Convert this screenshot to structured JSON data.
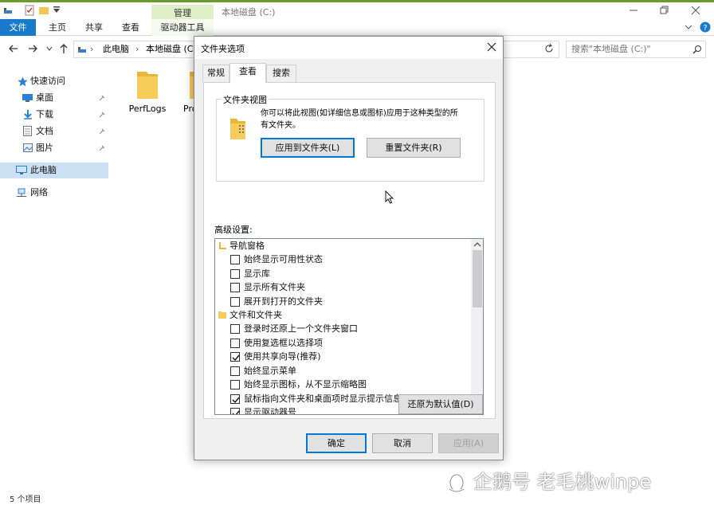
{
  "explorer": {
    "title": "本地磁盘 (C:)",
    "contextual_tab": "管理",
    "ribbon_tabs": [
      "文件",
      "主页",
      "共享",
      "查看",
      "驱动器工具"
    ],
    "address": {
      "this_pc": "此电脑",
      "drive": "本地磁盘 (C:)"
    },
    "search_placeholder": "搜索\"本地磁盘 (C:)\"",
    "nav": {
      "quick_access": "快速访问",
      "desktop": "桌面",
      "downloads": "下载",
      "documents": "文档",
      "pictures": "图片",
      "this_pc": "此电脑",
      "network": "网络"
    },
    "folders": [
      "PerfLogs",
      "Pro"
    ],
    "status": "5 个项目"
  },
  "dialog": {
    "title": "文件夹选项",
    "tabs": [
      "常规",
      "查看",
      "搜索"
    ],
    "folder_views": {
      "legend": "文件夹视图",
      "description_line1": "你可以将此视图(如详细信息或图标)应用于这种类型的所",
      "description_line2": "有文件夹。",
      "apply_button": "应用到文件夹(L)",
      "reset_button": "重置文件夹(R)"
    },
    "advanced_label": "高级设置:",
    "advanced": {
      "group_nav": "导航窗格",
      "nav_items": [
        {
          "label": "始终显示可用性状态",
          "checked": false
        },
        {
          "label": "显示库",
          "checked": false
        },
        {
          "label": "显示所有文件夹",
          "checked": false
        },
        {
          "label": "展开到打开的文件夹",
          "checked": false
        }
      ],
      "group_files": "文件和文件夹",
      "file_items": [
        {
          "label": "登录时还原上一个文件夹窗口",
          "checked": false
        },
        {
          "label": "使用复选框以选择项",
          "checked": false
        },
        {
          "label": "使用共享向导(推荐)",
          "checked": true
        },
        {
          "label": "始终显示菜单",
          "checked": false
        },
        {
          "label": "始终显示图标，从不显示缩略图",
          "checked": false
        },
        {
          "label": "鼠标指向文件夹和桌面项时显示提示信息",
          "checked": true
        },
        {
          "label": "显示驱动器号",
          "checked": true
        }
      ]
    },
    "restore_defaults_button": "还原为默认值(D)",
    "ok_button": "确定",
    "cancel_button": "取消",
    "apply_button": "应用(A)"
  },
  "watermark": "企鹅号 老毛桃winpe",
  "colors": {
    "accent_blue": "#1979ca",
    "manage_band": "#dff0c8",
    "title_green": "#6a9c2f"
  }
}
